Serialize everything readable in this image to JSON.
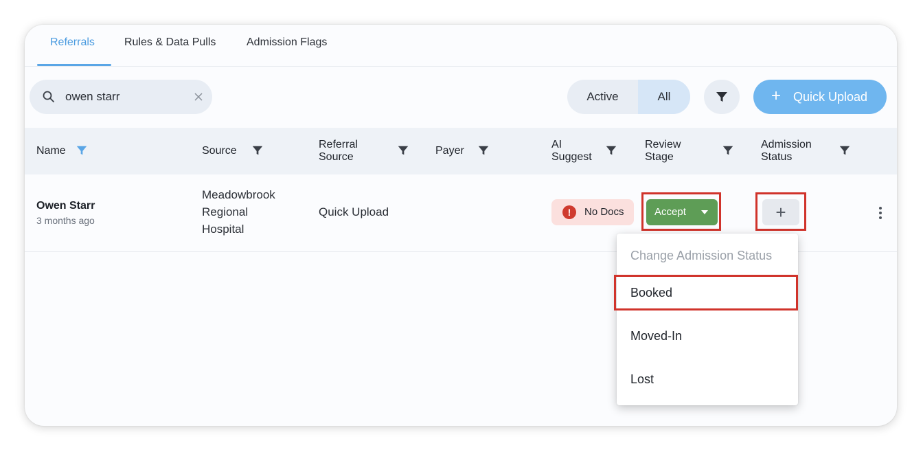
{
  "tabs": [
    {
      "label": "Referrals",
      "active": true
    },
    {
      "label": "Rules & Data Pulls",
      "active": false
    },
    {
      "label": "Admission Flags",
      "active": false
    }
  ],
  "search": {
    "value": "owen starr",
    "icon": "search-icon"
  },
  "toggle": {
    "active_label": "Active",
    "all_label": "All",
    "selected": "All"
  },
  "quick_upload": {
    "label": "Quick Upload"
  },
  "columns": {
    "name": "Name",
    "source": "Source",
    "referral_source_1": "Referral",
    "referral_source_2": "Source",
    "payer": "Payer",
    "ai_1": "AI",
    "ai_2": "Suggest",
    "review_1": "Review",
    "review_2": "Stage",
    "admission_1": "Admission",
    "admission_2": "Status"
  },
  "row": {
    "name": "Owen Starr",
    "time": "3 months ago",
    "source_lines": [
      "Meadowbrook",
      "Regional",
      "Hospital"
    ],
    "referral_source": "Quick Upload",
    "payer": "",
    "ai_badge": "No Docs",
    "review_stage": "Accept",
    "admission_add": "+"
  },
  "menu": {
    "header": "Change Admission Status",
    "items": [
      "Booked",
      "Moved-In",
      "Lost"
    ],
    "highlighted": "Booked"
  },
  "colors": {
    "accent": "#5aa6e6",
    "accept_green": "#5e9d56",
    "highlight_red": "#d0332b",
    "nodocs_bg": "#fbe0de"
  }
}
